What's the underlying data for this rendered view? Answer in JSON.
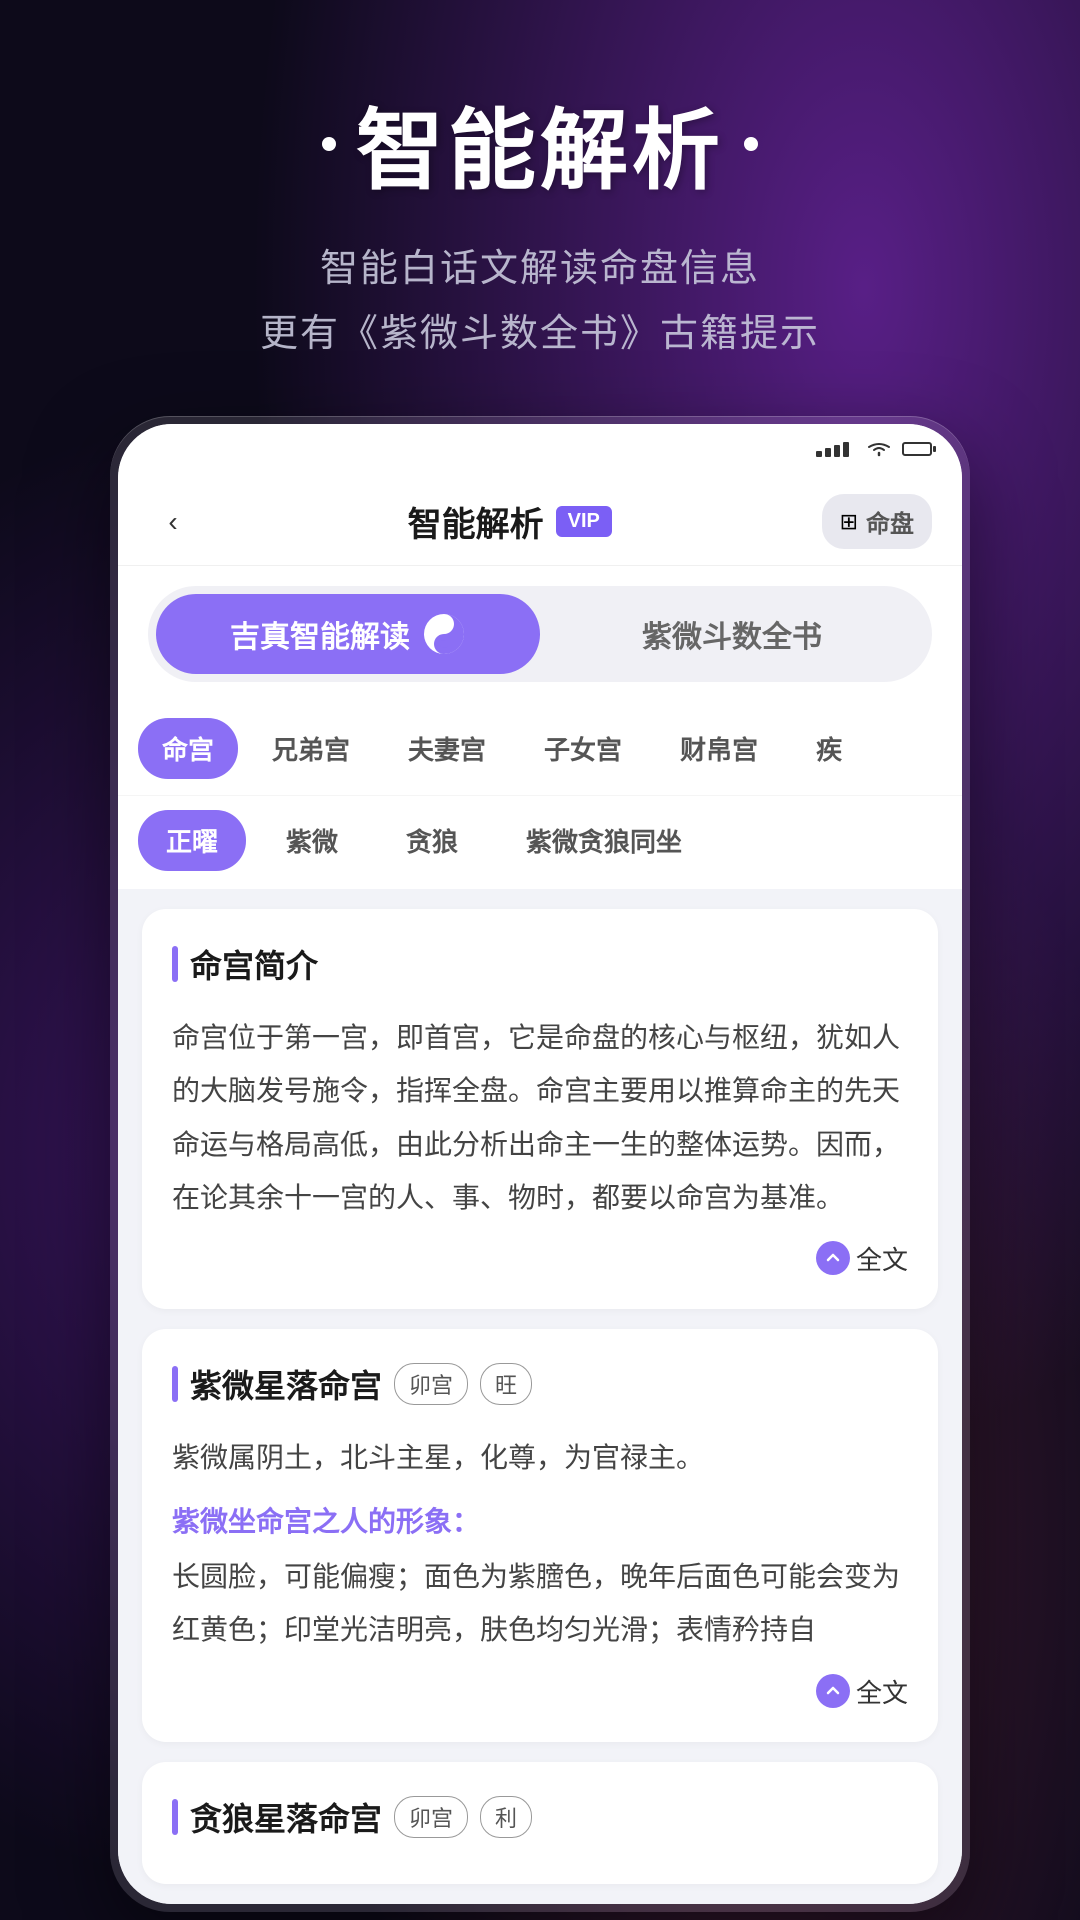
{
  "background": {
    "color": "#0d0a1a"
  },
  "header": {
    "title": "智能解析",
    "subtitle_line1": "智能白话文解读命盘信息",
    "subtitle_line2": "更有《紫微斗数全书》古籍提示",
    "dot": "•"
  },
  "app_bar": {
    "back_label": "‹",
    "title": "智能解析",
    "vip_label": "VIP",
    "mingpan_label": "命盘"
  },
  "toggle": {
    "left_label": "吉真智能解读",
    "right_label": "紫微斗数全书"
  },
  "tabs1": {
    "items": [
      "命宫",
      "兄弟宫",
      "夫妻宫",
      "子女宫",
      "财帛宫",
      "疾"
    ],
    "active_index": 0
  },
  "tabs2": {
    "items": [
      "正曜",
      "紫微",
      "贪狼",
      "紫微贪狼同坐"
    ],
    "active_index": 0
  },
  "card1": {
    "title": "命宫简介",
    "body": "命宫位于第一宫，即首宫，它是命盘的核心与枢纽，犹如人的大脑发号施令，指挥全盘。命宫主要用以推算命主的先天命运与格局高低，由此分析出命主一生的整体运势。因而，在论其余十一宫的人、事、物时，都要以命宫为基准。",
    "read_more": "全文"
  },
  "card2": {
    "title": "紫微星落命宫",
    "badges": [
      "卯宫",
      "旺"
    ],
    "body": "紫微属阴土，北斗主星，化尊，为官禄主。",
    "purple_subtitle": "紫微坐命宫之人的形象：",
    "body2": "长圆脸，可能偏瘦；面色为紫膪色，晚年后面色可能会变为红黄色；印堂光洁明亮，肤色均匀光滑；表情矜持自",
    "read_more": "全文"
  },
  "card3": {
    "title": "贪狼星落命宫",
    "badges": [
      "卯宫",
      "利"
    ]
  }
}
